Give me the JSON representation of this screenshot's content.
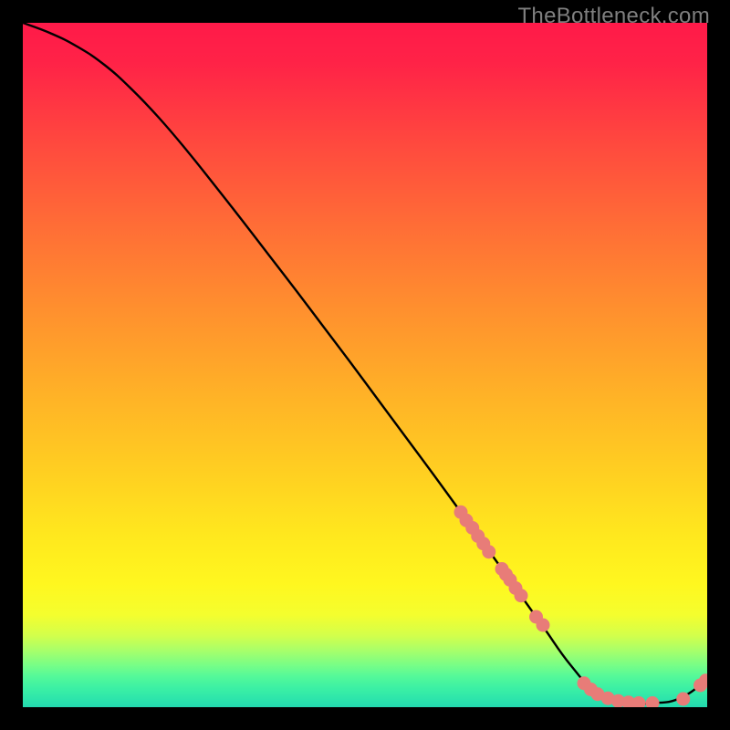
{
  "watermark": "TheBottleneck.com",
  "chart_data": {
    "type": "line",
    "title": "",
    "xlabel": "",
    "ylabel": "",
    "xlim": [
      0,
      100
    ],
    "ylim": [
      0,
      100
    ],
    "grid": false,
    "series": [
      {
        "name": "bottleneck-curve",
        "x": [
          0,
          4,
          8,
          12,
          16,
          20,
          24,
          28,
          32,
          36,
          40,
          44,
          48,
          52,
          56,
          60,
          64,
          68,
          72,
          76,
          80,
          84,
          88,
          92,
          96,
          100
        ],
        "y": [
          100,
          98.5,
          96.5,
          93.8,
          90.2,
          86.0,
          81.3,
          76.3,
          71.2,
          66.0,
          60.8,
          55.5,
          50.2,
          44.8,
          39.4,
          34.0,
          28.5,
          23.0,
          17.4,
          11.8,
          6.2,
          2.0,
          0.7,
          0.6,
          1.3,
          4.0
        ]
      }
    ],
    "markers": {
      "name": "highlight-points",
      "color": "#e87c78",
      "x": [
        64.0,
        64.8,
        65.7,
        66.5,
        67.3,
        68.1,
        70.0,
        70.6,
        71.2,
        72.0,
        72.8,
        75.0,
        76.0,
        82.0,
        83.0,
        84.0,
        85.5,
        87.0,
        88.5,
        90.0,
        92.0,
        96.5,
        99.0,
        99.8
      ],
      "y": [
        28.5,
        27.3,
        26.2,
        25.0,
        23.9,
        22.7,
        20.2,
        19.4,
        18.6,
        17.4,
        16.3,
        13.2,
        12.0,
        3.5,
        2.6,
        1.9,
        1.3,
        0.9,
        0.7,
        0.6,
        0.6,
        1.2,
        3.2,
        3.9
      ]
    },
    "gradient_stops": [
      {
        "offset": 0.0,
        "color": "#ff1a49"
      },
      {
        "offset": 0.06,
        "color": "#ff2347"
      },
      {
        "offset": 0.18,
        "color": "#ff4a3e"
      },
      {
        "offset": 0.3,
        "color": "#ff6e36"
      },
      {
        "offset": 0.42,
        "color": "#ff902e"
      },
      {
        "offset": 0.54,
        "color": "#ffb127"
      },
      {
        "offset": 0.66,
        "color": "#ffd021"
      },
      {
        "offset": 0.75,
        "color": "#ffe81e"
      },
      {
        "offset": 0.82,
        "color": "#fff71f"
      },
      {
        "offset": 0.865,
        "color": "#f4fe2e"
      },
      {
        "offset": 0.895,
        "color": "#d3ff4b"
      },
      {
        "offset": 0.918,
        "color": "#a6ff6b"
      },
      {
        "offset": 0.938,
        "color": "#79fe86"
      },
      {
        "offset": 0.955,
        "color": "#54f999"
      },
      {
        "offset": 0.972,
        "color": "#3cf0a4"
      },
      {
        "offset": 0.988,
        "color": "#2de5ab"
      },
      {
        "offset": 1.0,
        "color": "#23d9af"
      }
    ]
  }
}
